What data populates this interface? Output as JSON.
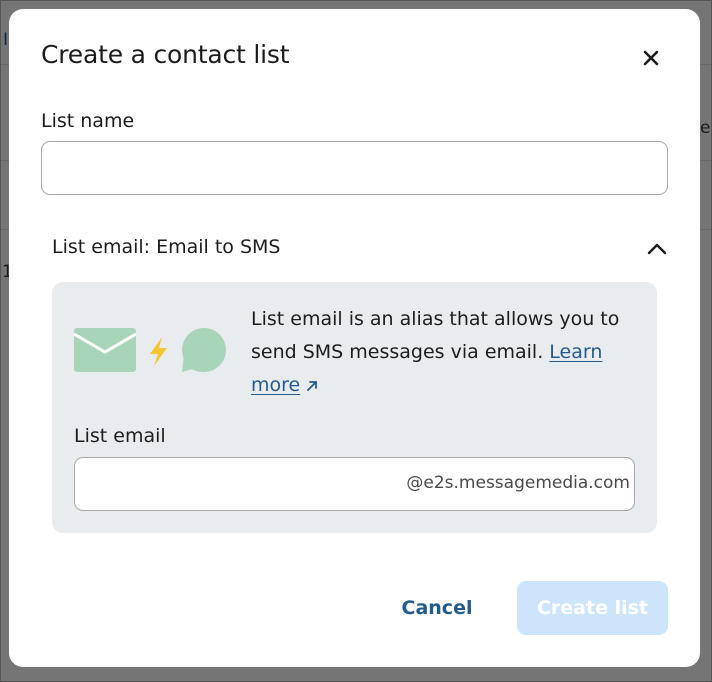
{
  "background": {
    "fragments": [
      "I",
      "er",
      "1"
    ]
  },
  "modal": {
    "title": "Create a contact list",
    "close_icon": "close-icon",
    "list_name": {
      "label": "List name",
      "value": "",
      "placeholder": ""
    },
    "section": {
      "title": "List email: Email to SMS",
      "toggle_icon": "chevron-up-icon",
      "expanded": true
    },
    "info": {
      "illustration_icons": [
        "envelope-icon",
        "lightning-icon",
        "speech-bubble-icon"
      ],
      "text": "List email is an alias that allows you to send SMS messages via email. ",
      "link_text": "Learn more",
      "link_icon": "external-link-icon"
    },
    "list_email": {
      "label": "List email",
      "value": "",
      "suffix": "@e2s.messagemedia.com"
    },
    "actions": {
      "cancel_label": "Cancel",
      "create_label": "Create list",
      "create_disabled": true
    }
  },
  "colors": {
    "primary": "#245b8e",
    "disabled_button": "#cde5fb",
    "panel": "#e9ecef",
    "illustration": "#a8d5b9",
    "bolt": "#f7c531"
  }
}
